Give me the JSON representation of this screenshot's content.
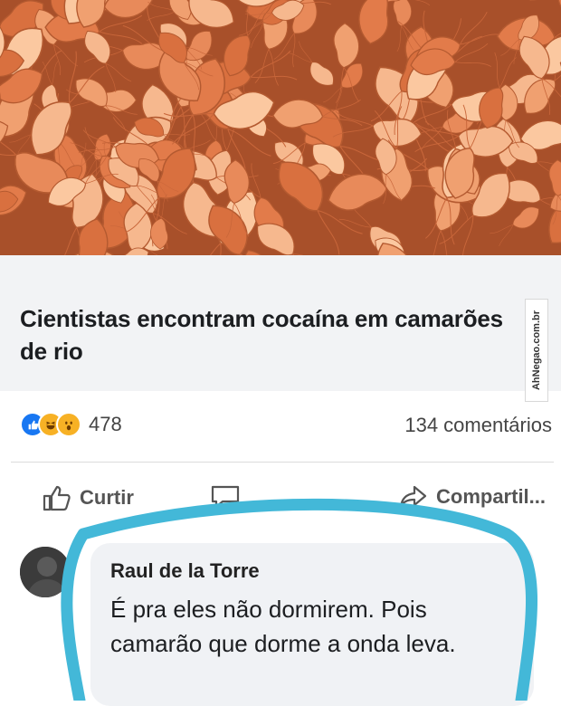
{
  "post": {
    "headline": "Cientistas encontram cocaína em camarões de rio",
    "watermark": "AhNegao.com.br",
    "reactions": {
      "icons": [
        "like-icon",
        "haha-icon",
        "wow-icon"
      ],
      "count": "478"
    },
    "comments_count": "134 comentários"
  },
  "actions": {
    "like_label": "Curtir",
    "share_label": "Compartil..."
  },
  "comment": {
    "author": "Raul de la Torre",
    "text": "É pra eles não dormirem. Pois camarão que dorme a onda leva."
  },
  "colors": {
    "highlight": "#43b8d8",
    "like": "#1877f2",
    "card_bg": "#f2f3f5"
  }
}
